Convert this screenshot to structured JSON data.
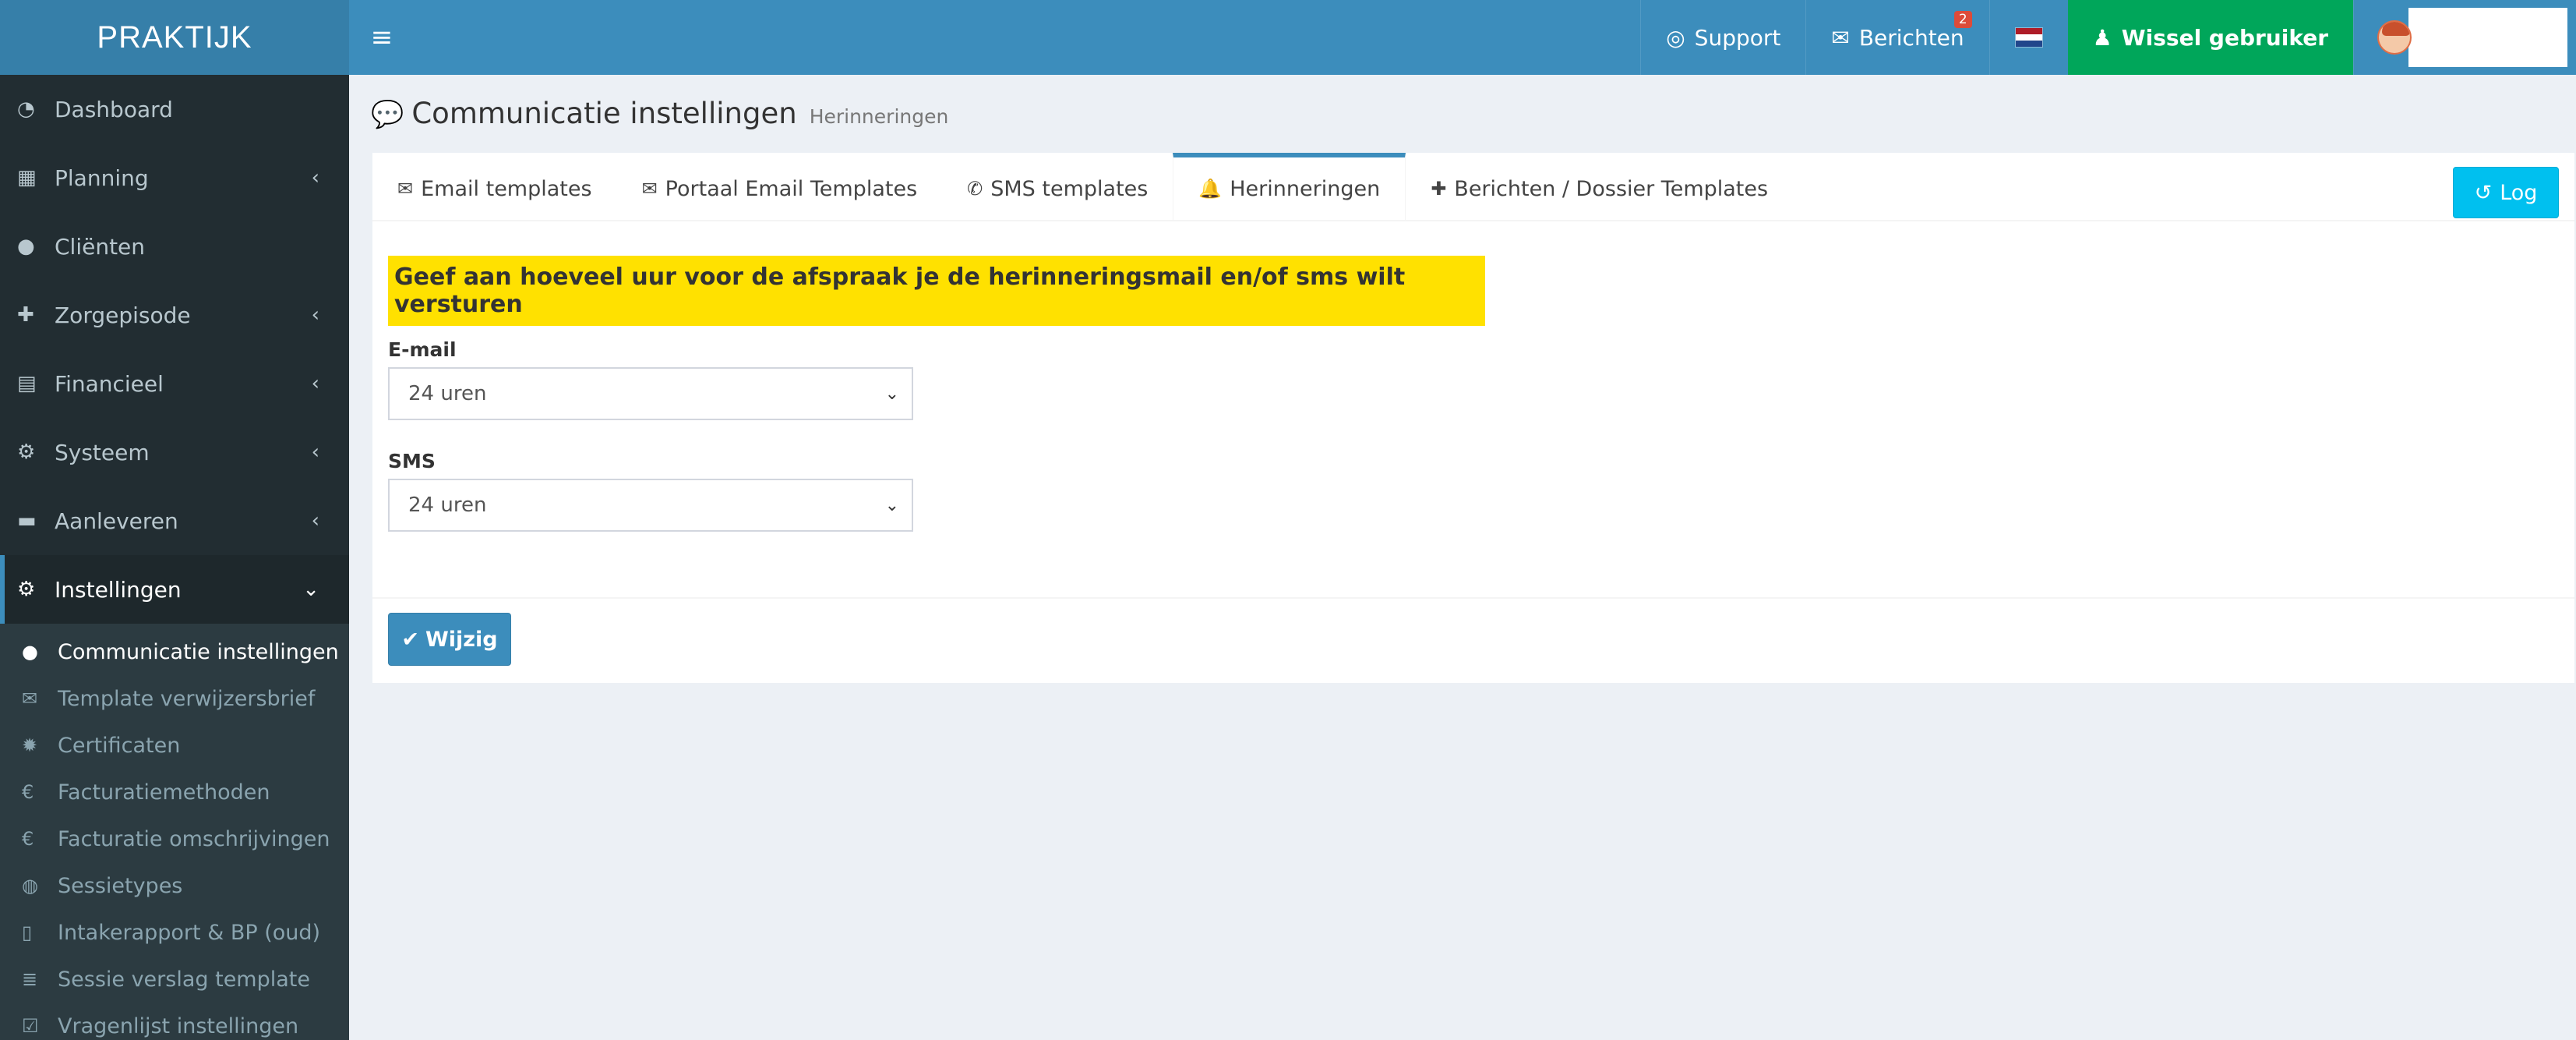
{
  "brand": {
    "logo_text": "PRAKTIJK"
  },
  "header": {
    "menu_toggle_icon": "hamburger-icon",
    "support_label": "Support",
    "messages_label": "Berichten",
    "messages_badge": "2",
    "switch_user_label": "Wissel gebruiker",
    "language_flag": "NL"
  },
  "colors": {
    "navbar": "#3c8dbc",
    "logo_bg": "#367fa9",
    "sidebar_bg": "#222d32",
    "switch_user_bg": "#00a65a",
    "highlight": "#ffe100",
    "log_button": "#00c0ef",
    "primary_button": "#3c8dbc"
  },
  "sidebar": {
    "items": [
      {
        "label": "Dashboard",
        "icon": "dashboard-icon",
        "icon_glyph": "◔",
        "has_children": false
      },
      {
        "label": "Planning",
        "icon": "calendar-icon",
        "icon_glyph": "▦",
        "has_children": true
      },
      {
        "label": "Cliënten",
        "icon": "user-icon",
        "icon_glyph": "●",
        "has_children": false
      },
      {
        "label": "Zorgepisode",
        "icon": "medkit-icon",
        "icon_glyph": "✚",
        "has_children": true
      },
      {
        "label": "Financieel",
        "icon": "book-icon",
        "icon_glyph": "▤",
        "has_children": true
      },
      {
        "label": "Systeem",
        "icon": "cogs-icon",
        "icon_glyph": "⚙",
        "has_children": true
      },
      {
        "label": "Aanleveren",
        "icon": "truck-icon",
        "icon_glyph": "▬",
        "has_children": true
      },
      {
        "label": "Instellingen",
        "icon": "gear-icon",
        "icon_glyph": "⚙",
        "has_children": true,
        "expanded": true
      }
    ],
    "submenu": [
      {
        "label": "Communicatie instellingen",
        "icon": "comments-icon",
        "icon_glyph": "●",
        "current": true
      },
      {
        "label": "Template verwijzersbrief",
        "icon": "envelope-icon",
        "icon_glyph": "✉"
      },
      {
        "label": "Certificaten",
        "icon": "certificate-icon",
        "icon_glyph": "✹"
      },
      {
        "label": "Facturatiemethoden",
        "icon": "euro-icon",
        "icon_glyph": "€"
      },
      {
        "label": "Facturatie omschrijvingen",
        "icon": "euro-icon",
        "icon_glyph": "€"
      },
      {
        "label": "Sessietypes",
        "icon": "globe-icon",
        "icon_glyph": "◍"
      },
      {
        "label": "Intakerapport & BP (oud)",
        "icon": "file-icon",
        "icon_glyph": "▯"
      },
      {
        "label": "Sessie verslag template",
        "icon": "list-icon",
        "icon_glyph": "≣"
      },
      {
        "label": "Vragenlijst instellingen",
        "icon": "checkbox-icon",
        "icon_glyph": "☑"
      }
    ]
  },
  "page": {
    "title": "Communicatie instellingen",
    "subtitle": "Herinneringen"
  },
  "tabs": [
    {
      "label": "Email templates",
      "icon": "envelope-icon",
      "icon_glyph": "✉"
    },
    {
      "label": "Portaal Email Templates",
      "icon": "envelope-icon",
      "icon_glyph": "✉"
    },
    {
      "label": "SMS templates",
      "icon": "phone-icon",
      "icon_glyph": "✆"
    },
    {
      "label": "Herinneringen",
      "icon": "bell-icon",
      "icon_glyph": "🔔",
      "active": true
    },
    {
      "label": "Berichten / Dossier Templates",
      "icon": "medkit-icon",
      "icon_glyph": "✚"
    }
  ],
  "log_button": {
    "label": "Log"
  },
  "form": {
    "legend": "Geef aan hoeveel uur voor de afspraak je de herinneringsmail en/of sms wilt versturen",
    "email": {
      "label": "E-mail",
      "value": "24 uren"
    },
    "sms": {
      "label": "SMS",
      "value": "24 uren"
    },
    "submit_label": "Wijzig"
  }
}
